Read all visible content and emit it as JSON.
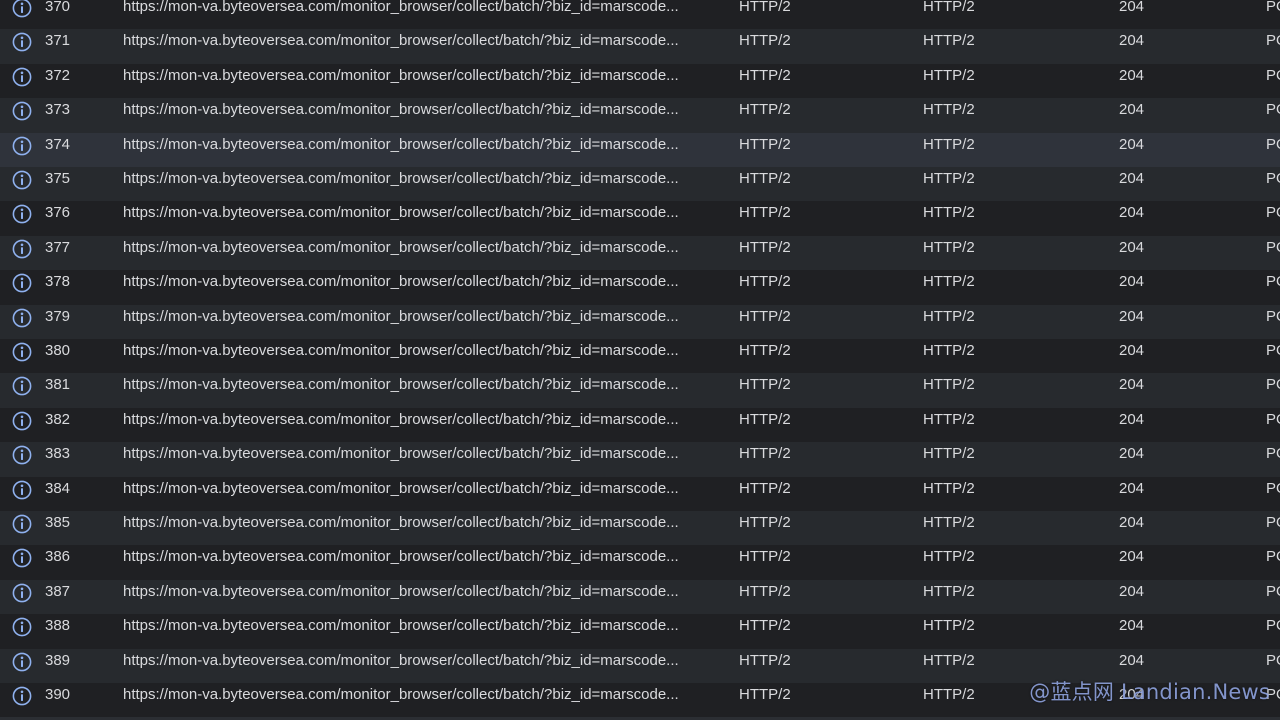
{
  "watermark": "@蓝点网 Landian.News",
  "rows": [
    {
      "id": "370",
      "url": "https://mon-va.byteoversea.com/monitor_browser/collect/batch/?biz_id=marscode...",
      "protocol": "HTTP/2",
      "protocol2": "HTTP/2",
      "status": "204",
      "method": "POST"
    },
    {
      "id": "371",
      "url": "https://mon-va.byteoversea.com/monitor_browser/collect/batch/?biz_id=marscode...",
      "protocol": "HTTP/2",
      "protocol2": "HTTP/2",
      "status": "204",
      "method": "POST"
    },
    {
      "id": "372",
      "url": "https://mon-va.byteoversea.com/monitor_browser/collect/batch/?biz_id=marscode...",
      "protocol": "HTTP/2",
      "protocol2": "HTTP/2",
      "status": "204",
      "method": "POST"
    },
    {
      "id": "373",
      "url": "https://mon-va.byteoversea.com/monitor_browser/collect/batch/?biz_id=marscode...",
      "protocol": "HTTP/2",
      "protocol2": "HTTP/2",
      "status": "204",
      "method": "POST"
    },
    {
      "id": "374",
      "url": "https://mon-va.byteoversea.com/monitor_browser/collect/batch/?biz_id=marscode...",
      "protocol": "HTTP/2",
      "protocol2": "HTTP/2",
      "status": "204",
      "method": "POST",
      "selected": true
    },
    {
      "id": "375",
      "url": "https://mon-va.byteoversea.com/monitor_browser/collect/batch/?biz_id=marscode...",
      "protocol": "HTTP/2",
      "protocol2": "HTTP/2",
      "status": "204",
      "method": "POST"
    },
    {
      "id": "376",
      "url": "https://mon-va.byteoversea.com/monitor_browser/collect/batch/?biz_id=marscode...",
      "protocol": "HTTP/2",
      "protocol2": "HTTP/2",
      "status": "204",
      "method": "POST"
    },
    {
      "id": "377",
      "url": "https://mon-va.byteoversea.com/monitor_browser/collect/batch/?biz_id=marscode...",
      "protocol": "HTTP/2",
      "protocol2": "HTTP/2",
      "status": "204",
      "method": "POST"
    },
    {
      "id": "378",
      "url": "https://mon-va.byteoversea.com/monitor_browser/collect/batch/?biz_id=marscode...",
      "protocol": "HTTP/2",
      "protocol2": "HTTP/2",
      "status": "204",
      "method": "POST"
    },
    {
      "id": "379",
      "url": "https://mon-va.byteoversea.com/monitor_browser/collect/batch/?biz_id=marscode...",
      "protocol": "HTTP/2",
      "protocol2": "HTTP/2",
      "status": "204",
      "method": "POST"
    },
    {
      "id": "380",
      "url": "https://mon-va.byteoversea.com/monitor_browser/collect/batch/?biz_id=marscode...",
      "protocol": "HTTP/2",
      "protocol2": "HTTP/2",
      "status": "204",
      "method": "POST"
    },
    {
      "id": "381",
      "url": "https://mon-va.byteoversea.com/monitor_browser/collect/batch/?biz_id=marscode...",
      "protocol": "HTTP/2",
      "protocol2": "HTTP/2",
      "status": "204",
      "method": "POST"
    },
    {
      "id": "382",
      "url": "https://mon-va.byteoversea.com/monitor_browser/collect/batch/?biz_id=marscode...",
      "protocol": "HTTP/2",
      "protocol2": "HTTP/2",
      "status": "204",
      "method": "POST"
    },
    {
      "id": "383",
      "url": "https://mon-va.byteoversea.com/monitor_browser/collect/batch/?biz_id=marscode...",
      "protocol": "HTTP/2",
      "protocol2": "HTTP/2",
      "status": "204",
      "method": "POST"
    },
    {
      "id": "384",
      "url": "https://mon-va.byteoversea.com/monitor_browser/collect/batch/?biz_id=marscode...",
      "protocol": "HTTP/2",
      "protocol2": "HTTP/2",
      "status": "204",
      "method": "POST"
    },
    {
      "id": "385",
      "url": "https://mon-va.byteoversea.com/monitor_browser/collect/batch/?biz_id=marscode...",
      "protocol": "HTTP/2",
      "protocol2": "HTTP/2",
      "status": "204",
      "method": "POST"
    },
    {
      "id": "386",
      "url": "https://mon-va.byteoversea.com/monitor_browser/collect/batch/?biz_id=marscode...",
      "protocol": "HTTP/2",
      "protocol2": "HTTP/2",
      "status": "204",
      "method": "POST"
    },
    {
      "id": "387",
      "url": "https://mon-va.byteoversea.com/monitor_browser/collect/batch/?biz_id=marscode...",
      "protocol": "HTTP/2",
      "protocol2": "HTTP/2",
      "status": "204",
      "method": "POST"
    },
    {
      "id": "388",
      "url": "https://mon-va.byteoversea.com/monitor_browser/collect/batch/?biz_id=marscode...",
      "protocol": "HTTP/2",
      "protocol2": "HTTP/2",
      "status": "204",
      "method": "POST"
    },
    {
      "id": "389",
      "url": "https://mon-va.byteoversea.com/monitor_browser/collect/batch/?biz_id=marscode...",
      "protocol": "HTTP/2",
      "protocol2": "HTTP/2",
      "status": "204",
      "method": "POST"
    },
    {
      "id": "390",
      "url": "https://mon-va.byteoversea.com/monitor_browser/collect/batch/?biz_id=marscode...",
      "protocol": "HTTP/2",
      "protocol2": "HTTP/2",
      "status": "204",
      "method": "POST"
    }
  ]
}
